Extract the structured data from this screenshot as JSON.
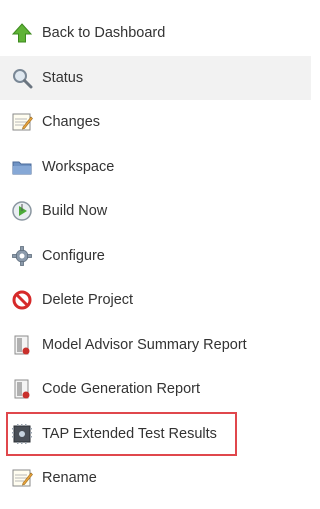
{
  "menu": {
    "items": [
      {
        "label": "Back to Dashboard",
        "icon": "up-arrow-icon"
      },
      {
        "label": "Status",
        "icon": "magnifier-icon"
      },
      {
        "label": "Changes",
        "icon": "notepad-icon"
      },
      {
        "label": "Workspace",
        "icon": "folder-icon"
      },
      {
        "label": "Build Now",
        "icon": "clock-play-icon"
      },
      {
        "label": "Configure",
        "icon": "gear-icon"
      },
      {
        "label": "Delete Project",
        "icon": "no-entry-icon"
      },
      {
        "label": "Model Advisor Summary Report",
        "icon": "report-icon"
      },
      {
        "label": "Code Generation Report",
        "icon": "report-icon"
      },
      {
        "label": "TAP Extended Test Results",
        "icon": "chip-icon"
      },
      {
        "label": "Rename",
        "icon": "notepad-icon"
      }
    ]
  },
  "colors": {
    "active_bg": "#f2f2f2",
    "highlight_border": "#e0474c",
    "text": "#333333"
  }
}
